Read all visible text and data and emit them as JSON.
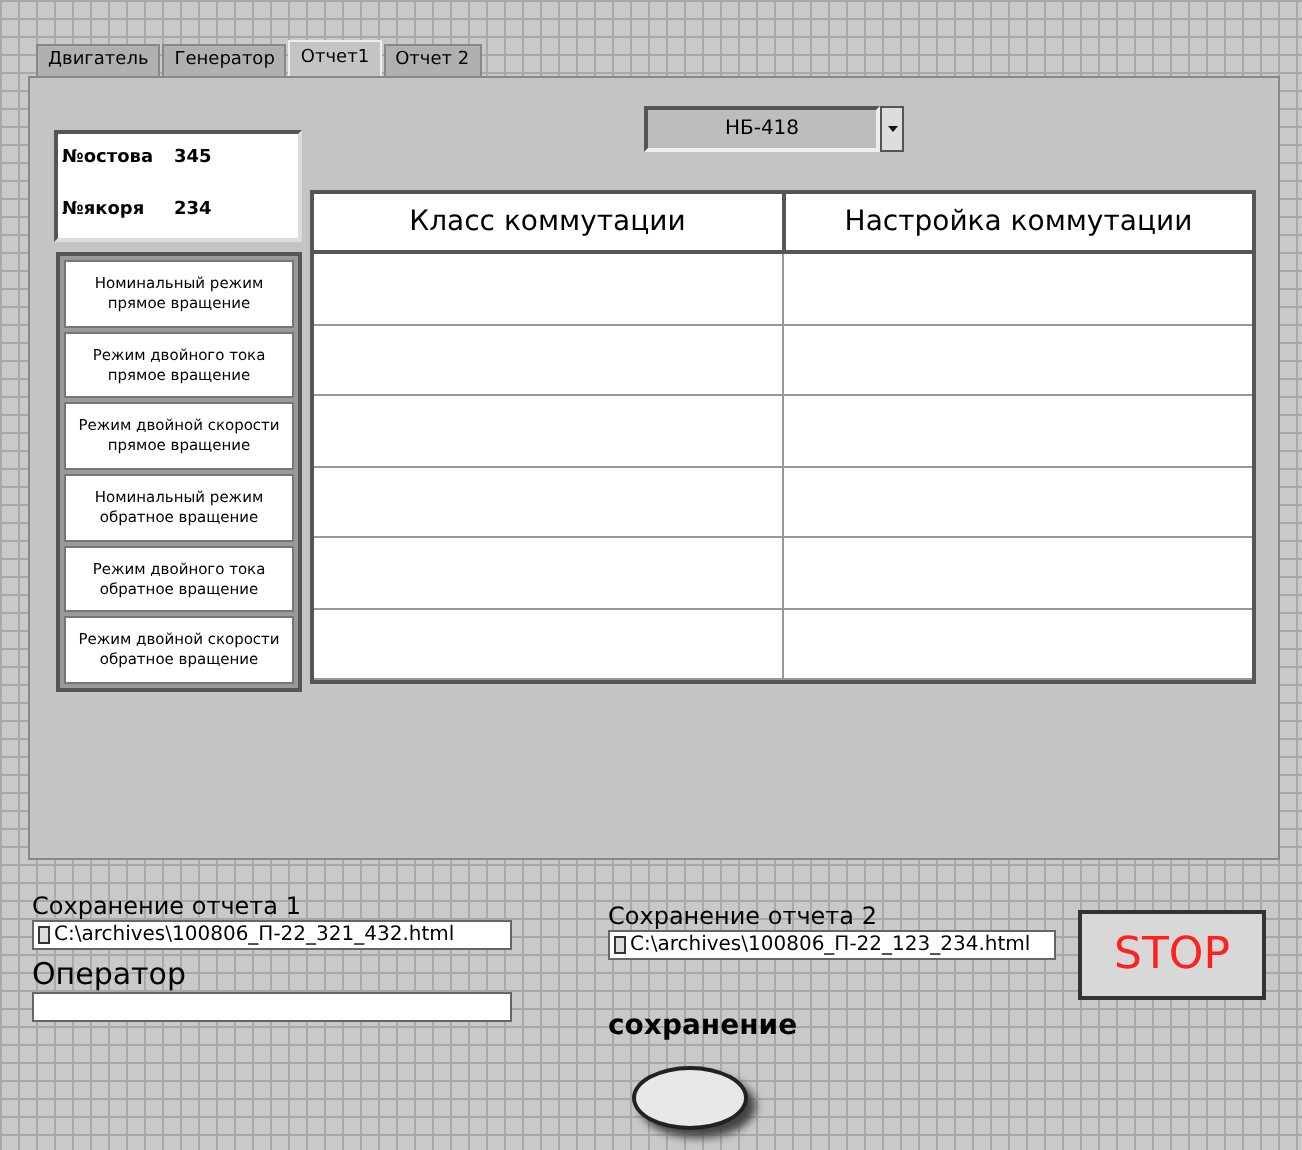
{
  "tabs": [
    {
      "label": "Двигатель",
      "selected": false
    },
    {
      "label": "Генератор",
      "selected": false
    },
    {
      "label": "Отчет1",
      "selected": true
    },
    {
      "label": "Отчет 2",
      "selected": false
    }
  ],
  "info": [
    {
      "label": "№остова",
      "value": "345"
    },
    {
      "label": "№якоря",
      "value": "234"
    }
  ],
  "model_select": {
    "value": "НБ-418"
  },
  "table": {
    "columns": [
      "Класс коммутации",
      "Настройка коммутации"
    ]
  },
  "modes": [
    {
      "label": "Номинальный режим прямое вращение"
    },
    {
      "label": "Режим двойного тока прямое вращение"
    },
    {
      "label": "Режим двойной скорости прямое  вращение"
    },
    {
      "label": "Номинальный режим обратное вращение"
    },
    {
      "label": "Режим двойного тока обратное вращение"
    },
    {
      "label": "Режим двойной скорости обратное вращение"
    }
  ],
  "report1": {
    "label": "Сохранение отчета 1",
    "value": "C:\\archives\\100806_П-22_321_432.html"
  },
  "operator": {
    "label": "Оператор"
  },
  "report2": {
    "label": "Сохранение отчета 2",
    "value": "C:\\archives\\100806_П-22_123_234.html"
  },
  "stop_button": {
    "label": "STOP"
  },
  "save_toggle": {
    "label": "сохранение",
    "on": false
  }
}
